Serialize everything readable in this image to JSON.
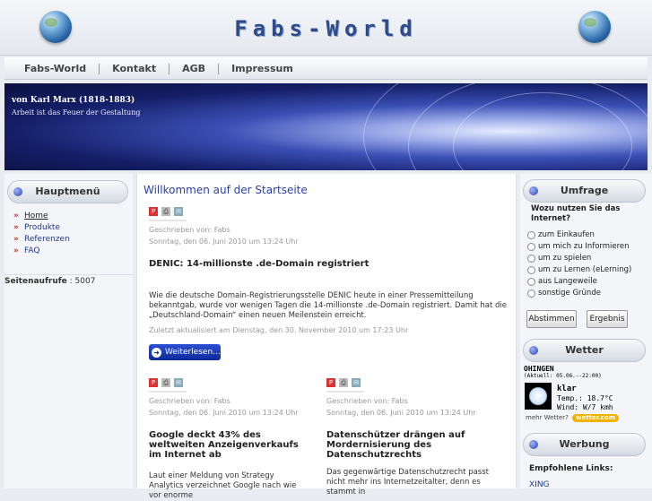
{
  "site": {
    "title": "Fabs-World"
  },
  "nav": {
    "items": [
      "Fabs-World",
      "Kontakt",
      "AGB",
      "Impressum"
    ]
  },
  "banner": {
    "quote_author": "von Karl Marx (1818-1883)",
    "quote_text": "Arbeit ist das Feuer der Gestaltung"
  },
  "main_menu": {
    "title": "Hauptmenü",
    "items": [
      "Home",
      "Produkte",
      "Referenzen",
      "FAQ"
    ]
  },
  "visits": {
    "label": "Seitenaufrufe",
    "count": ": 5007"
  },
  "content": {
    "heading": "Willkommen auf der Startseite",
    "article1": {
      "author": "Geschrieben von: Fabs",
      "date": "Sonntag, den 06. Juni 2010 um 13:24 Uhr",
      "title": "DENIC: 14-millionste .de-Domain registriert",
      "body": "Wie die deutsche Domain-Registrierungsstelle DENIC heute in einer Pressemitteilung bekanntgab, wurde vor wenigen Tagen die 14-millionste .de-Domain registriert. Damit hat die „Deutschland-Domain“ einen neuen Meilenstein erreicht.",
      "updated": "Zuletzt aktualisiert am Dienstag, den 30. November 2010 um 17:23 Uhr",
      "readmore": "Weiterlesen..."
    },
    "article2": {
      "author": "Geschrieben von: Fabs",
      "date": "Sonntag, den 06. Juni 2010 um 13:24 Uhr",
      "title": "Google deckt 43% des weltweiten Anzeigenverkaufs im Internet ab",
      "body": "Laut einer Meldung von Strategy Analytics verzeichnet Google nach wie vor enorme"
    },
    "article3": {
      "author": "Geschrieben von: Fabs",
      "date": "Sonntag, den 06. Juni 2010 um 13:24 Uhr",
      "title": "Datenschützer drängen auf Mordernisierung des Datenschutzrechts",
      "body": "Das gegenwärtige Datenschutzrecht passt nicht mehr ins Internetzeitalter, denn es stammt in"
    }
  },
  "poll": {
    "title": "Umfrage",
    "question": "Wozu nutzen Sie das Internet?",
    "options": [
      "zum Einkaufen",
      "um mich zu Informieren",
      "um zu spielen",
      "um zu Lernen (eLerning)",
      "aus Langeweile",
      "sonstige Gründe"
    ],
    "vote_label": "Abstimmen",
    "result_label": "Ergebnis"
  },
  "weather": {
    "title": "Wetter",
    "city": "OHINGEN",
    "updated": "(Aktuell: 05.06.--22:00)",
    "condition": "klar",
    "temp": "Temp.: 18.7°C",
    "wind": "Wind: W/7 kmh",
    "more": "mehr Wetter?",
    "badge": "wetter.com"
  },
  "ads": {
    "title": "Werbung",
    "label": "Empfohlene Links:",
    "link": "XING"
  },
  "icons": {
    "pdf": "pdf-icon",
    "print": "print-icon",
    "mail": "mail-icon"
  }
}
